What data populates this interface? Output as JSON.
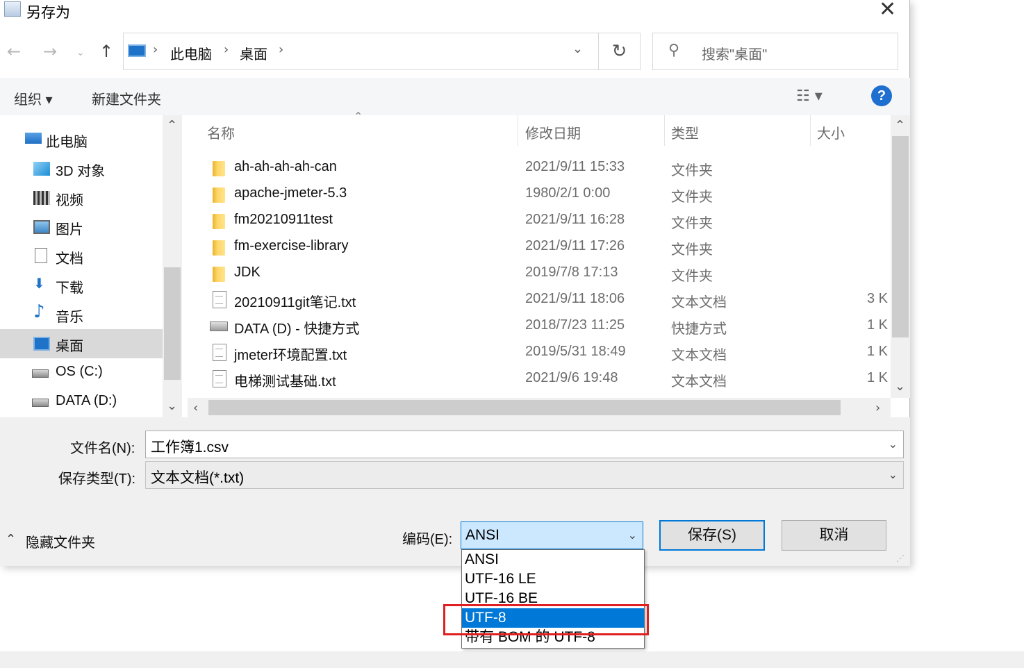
{
  "window": {
    "title": "另存为"
  },
  "breadcrumb": [
    "此电脑",
    "桌面"
  ],
  "search": {
    "placeholder": "搜索\"桌面\""
  },
  "toolbar": {
    "organize": "组织 ▾",
    "new_folder": "新建文件夹"
  },
  "nav_items": [
    {
      "label": "此电脑",
      "icon": "computer-icon"
    },
    {
      "label": "3D 对象",
      "icon": "cube-icon"
    },
    {
      "label": "视频",
      "icon": "film-icon"
    },
    {
      "label": "图片",
      "icon": "picture-icon"
    },
    {
      "label": "文档",
      "icon": "document-icon"
    },
    {
      "label": "下载",
      "icon": "download-icon"
    },
    {
      "label": "音乐",
      "icon": "music-icon"
    },
    {
      "label": "桌面",
      "icon": "desktop-icon",
      "selected": true
    },
    {
      "label": "OS (C:)",
      "icon": "drive-icon"
    },
    {
      "label": "DATA (D:)",
      "icon": "drive-icon"
    }
  ],
  "columns": {
    "name": "名称",
    "date": "修改日期",
    "type": "类型",
    "size": "大小"
  },
  "files": [
    {
      "name": "ah-ah-ah-ah-can",
      "date": "2021/9/11 15:33",
      "type": "文件夹",
      "size": "",
      "icon": "folder"
    },
    {
      "name": "apache-jmeter-5.3",
      "date": "1980/2/1 0:00",
      "type": "文件夹",
      "size": "",
      "icon": "folder"
    },
    {
      "name": "fm20210911test",
      "date": "2021/9/11 16:28",
      "type": "文件夹",
      "size": "",
      "icon": "folder"
    },
    {
      "name": "fm-exercise-library",
      "date": "2021/9/11 17:26",
      "type": "文件夹",
      "size": "",
      "icon": "folder"
    },
    {
      "name": "JDK",
      "date": "2019/7/8 17:13",
      "type": "文件夹",
      "size": "",
      "icon": "folder"
    },
    {
      "name": "20210911git笔记.txt",
      "date": "2021/9/11 18:06",
      "type": "文本文档",
      "size": "3 K",
      "icon": "doc"
    },
    {
      "name": "DATA (D) - 快捷方式",
      "date": "2018/7/23 11:25",
      "type": "快捷方式",
      "size": "1 K",
      "icon": "shortcut"
    },
    {
      "name": "jmeter环境配置.txt",
      "date": "2019/5/31 18:49",
      "type": "文本文档",
      "size": "1 K",
      "icon": "doc"
    },
    {
      "name": "电梯测试基础.txt",
      "date": "2021/9/6 19:48",
      "type": "文本文档",
      "size": "1 K",
      "icon": "doc"
    }
  ],
  "form": {
    "filename_label": "文件名(N):",
    "filename_value": "工作簿1.csv",
    "type_label": "保存类型(T):",
    "type_value": "文本文档(*.txt)",
    "hide_folders": "隐藏文件夹",
    "encoding_label": "编码(E):",
    "encoding_value": "ANSI",
    "save_button": "保存(S)",
    "cancel_button": "取消"
  },
  "encoding_options": [
    "ANSI",
    "UTF-16 LE",
    "UTF-16 BE",
    "UTF-8",
    "带有 BOM 的 UTF-8"
  ],
  "encoding_highlighted": "UTF-8",
  "colors": {
    "accent": "#0078d7",
    "highlight_box": "#e02020",
    "help": "#1f6fd1"
  }
}
